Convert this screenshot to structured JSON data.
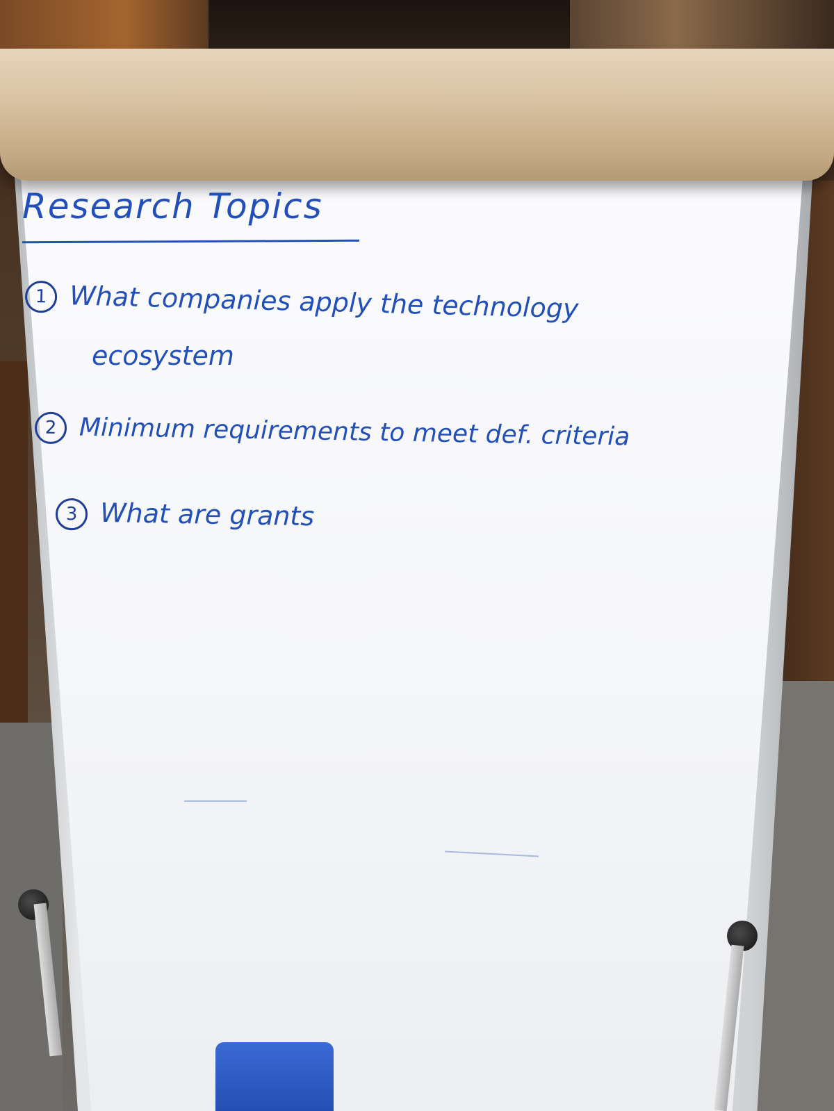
{
  "board": {
    "title": "Research Topics",
    "items": [
      {
        "number": "1",
        "text": "What companies apply the technology",
        "continuation": "ecosystem"
      },
      {
        "number": "2",
        "text": "Minimum requirements to meet def. criteria"
      },
      {
        "number": "3",
        "text": "What are grants"
      }
    ]
  },
  "colors": {
    "marker": "#2350b8",
    "board": "#f6f7fa",
    "paper_roll": "#d8c2a2",
    "eraser": "#2f5fc7"
  }
}
